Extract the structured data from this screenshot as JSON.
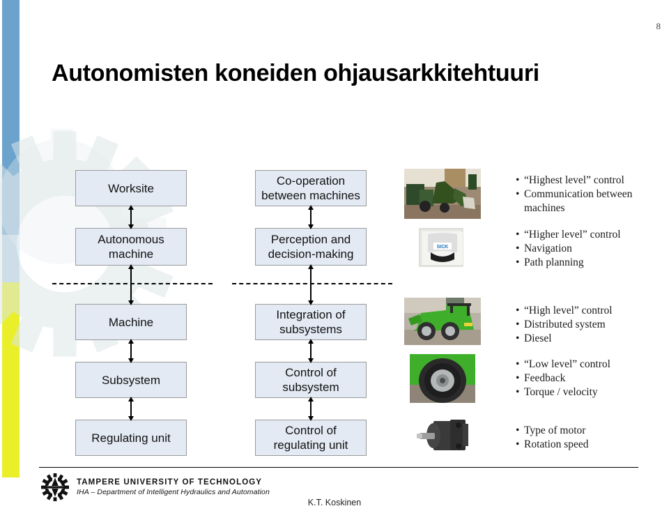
{
  "slide": {
    "page_number": "8",
    "title": "Autonomisten koneiden ohjausarkkitehtuuri",
    "author": "K.T. Koskinen"
  },
  "colors": {
    "stripe_blue": "#6ba3cd",
    "stripe_light_blue": "#bad6ea",
    "stripe_yellow": "#e9ef28",
    "box_fill": "#e3eaf4",
    "box_border": "#9a9a9a",
    "watermark": "#dde6e8"
  },
  "levels": [
    {
      "level_name": "Worksite",
      "function_name": "Co-operation\nbetween machines",
      "photo": "excavator-photo",
      "bullets": [
        "“Highest level” control",
        "Communication between",
        "machines"
      ],
      "bullet_continuation": [
        false,
        false,
        true
      ]
    },
    {
      "level_name": "Autonomous\nmachine",
      "function_name": "Perception and\ndecision-making",
      "photo": "laser-scanner-photo",
      "bullets": [
        "“Higher level” control",
        "Navigation",
        "Path planning"
      ],
      "bullet_continuation": [
        false,
        false,
        false
      ]
    },
    {
      "level_name": "Machine",
      "function_name": "Integration of\nsubsystems",
      "photo": "green-loader-photo",
      "bullets": [
        "“High level” control",
        "Distributed system",
        "Diesel"
      ],
      "bullet_continuation": [
        false,
        false,
        false
      ]
    },
    {
      "level_name": "Subsystem",
      "function_name": "Control of\nsubsystem",
      "photo": "wheel-photo",
      "bullets": [
        "“Low level” control",
        "Feedback",
        "Torque / velocity"
      ],
      "bullet_continuation": [
        false,
        false,
        false
      ]
    },
    {
      "level_name": "Regulating unit",
      "function_name": "Control of\nregulating unit",
      "photo": "hydraulic-motor-photo",
      "bullets": [
        "Type of motor",
        "Rotation speed"
      ],
      "bullet_continuation": [
        false,
        false
      ]
    }
  ],
  "logo": {
    "organisation": "TAMPERE UNIVERSITY OF TECHNOLOGY",
    "department": "IHA – Department of Intelligent Hydraulics and Automation"
  }
}
